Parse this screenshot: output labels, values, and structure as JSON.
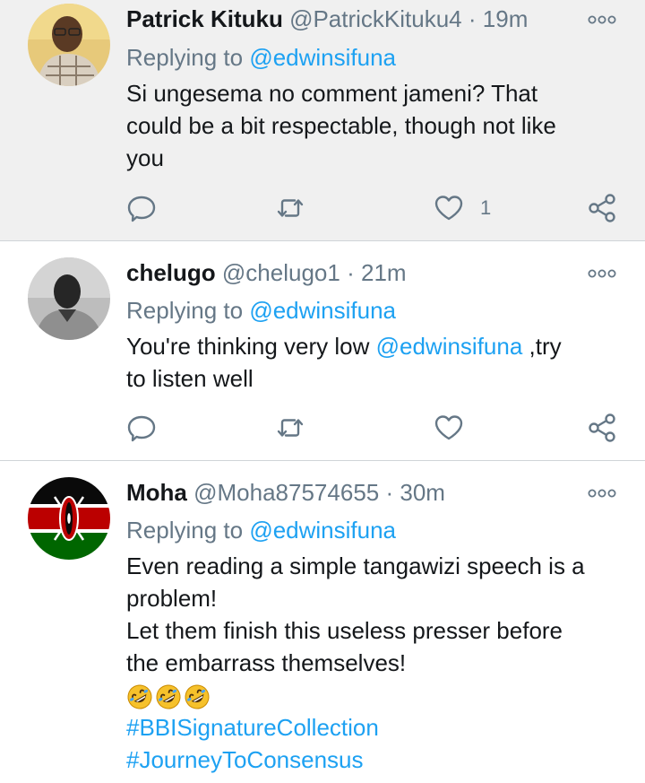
{
  "tweets": [
    {
      "name": "Patrick Kituku",
      "handle": "@PatrickKituku4",
      "separator": "·",
      "time": "19m",
      "replying_label": "Replying to",
      "replying_to": "@edwinsifuna",
      "body_lines": [
        "Si ungesema no comment jameni? That",
        "could be a bit respectable, though not like",
        "you"
      ],
      "like_count": "1",
      "avatar": "man-with-glasses-photo"
    },
    {
      "name": "chelugo",
      "handle": "@chelugo1",
      "separator": "·",
      "time": "21m",
      "replying_label": "Replying to",
      "replying_to": "@edwinsifuna",
      "body_line1_pre": "You're thinking very low ",
      "body_line1_mention": "@edwinsifuna",
      "body_line1_post": " ,try",
      "body_line2": "to listen well",
      "avatar": "grayscale-man-photo"
    },
    {
      "name": "Moha",
      "handle": "@Moha87574655",
      "separator": "·",
      "time": "30m",
      "replying_label": "Replying to",
      "replying_to": "@edwinsifuna",
      "body_lines": [
        "Even reading a simple tangawizi speech is a",
        "problem!",
        "Let them finish this useless presser before",
        "the embarrass themselves!"
      ],
      "emojis": [
        "rolling-on-floor-laughing",
        "rolling-on-floor-laughing",
        "rolling-on-floor-laughing"
      ],
      "hashtags": [
        "#BBISignatureCollection",
        "#JourneyToConsensus"
      ],
      "avatar": "kenya-flag"
    }
  ],
  "icons": {
    "reply": "reply-icon",
    "retweet": "retweet-icon",
    "like": "heart-icon",
    "share": "share-icon",
    "more": "more-options-icon"
  },
  "colors": {
    "link": "#1da1f2",
    "secondary_text": "#657786",
    "highlight_bg": "#f0f0f0"
  }
}
